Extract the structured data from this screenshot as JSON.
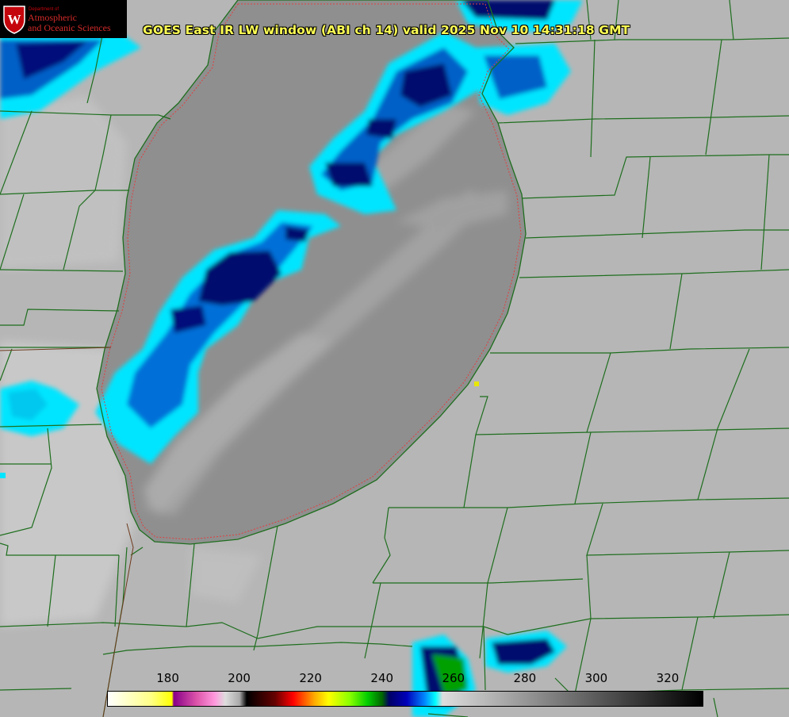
{
  "header": {
    "logo": {
      "department": "Department of",
      "line1": "Atmospheric",
      "line2": "and Oceanic Sciences",
      "crest_letter": "W"
    },
    "title": "GOES East IR LW window (ABI ch 14) valid 2025 Nov 10 14:31:18 GMT"
  },
  "colorbar": {
    "tick_labels": [
      "180",
      "200",
      "220",
      "240",
      "260",
      "280",
      "300",
      "320"
    ],
    "range_min": 163,
    "range_max": 330,
    "stops": [
      {
        "value": 163,
        "color": "#ffffff"
      },
      {
        "value": 175,
        "color": "#ffff88"
      },
      {
        "value": 181,
        "color": "#ffff00"
      },
      {
        "value": 181.5,
        "color": "#880088"
      },
      {
        "value": 188,
        "color": "#dd55aa"
      },
      {
        "value": 193,
        "color": "#ff99dd"
      },
      {
        "value": 196,
        "color": "#dddddd"
      },
      {
        "value": 200,
        "color": "#aaaaaa"
      },
      {
        "value": 202,
        "color": "#000000"
      },
      {
        "value": 210,
        "color": "#660000"
      },
      {
        "value": 215,
        "color": "#ff0000"
      },
      {
        "value": 221,
        "color": "#ffaa00"
      },
      {
        "value": 225,
        "color": "#ffff00"
      },
      {
        "value": 231,
        "color": "#88ff00"
      },
      {
        "value": 236,
        "color": "#00cc00"
      },
      {
        "value": 240,
        "color": "#006600"
      },
      {
        "value": 242,
        "color": "#000066"
      },
      {
        "value": 247,
        "color": "#0000bb"
      },
      {
        "value": 252,
        "color": "#0088ff"
      },
      {
        "value": 255,
        "color": "#00ffff"
      },
      {
        "value": 257,
        "color": "#dddddd"
      },
      {
        "value": 330,
        "color": "#000000"
      }
    ]
  },
  "colors": {
    "lake": "#8f8f8f",
    "land": "#b6b6b6",
    "land_light": "#c8c8c8",
    "boundary": "#1e6e1e",
    "shoreline_dashed": "#e04040",
    "cloud_cyan": "#00e5ff",
    "cloud_blue": "#0060c8",
    "cloud_navy": "#00086e",
    "cloud_green": "#00a000",
    "marker": "#e8e800"
  }
}
